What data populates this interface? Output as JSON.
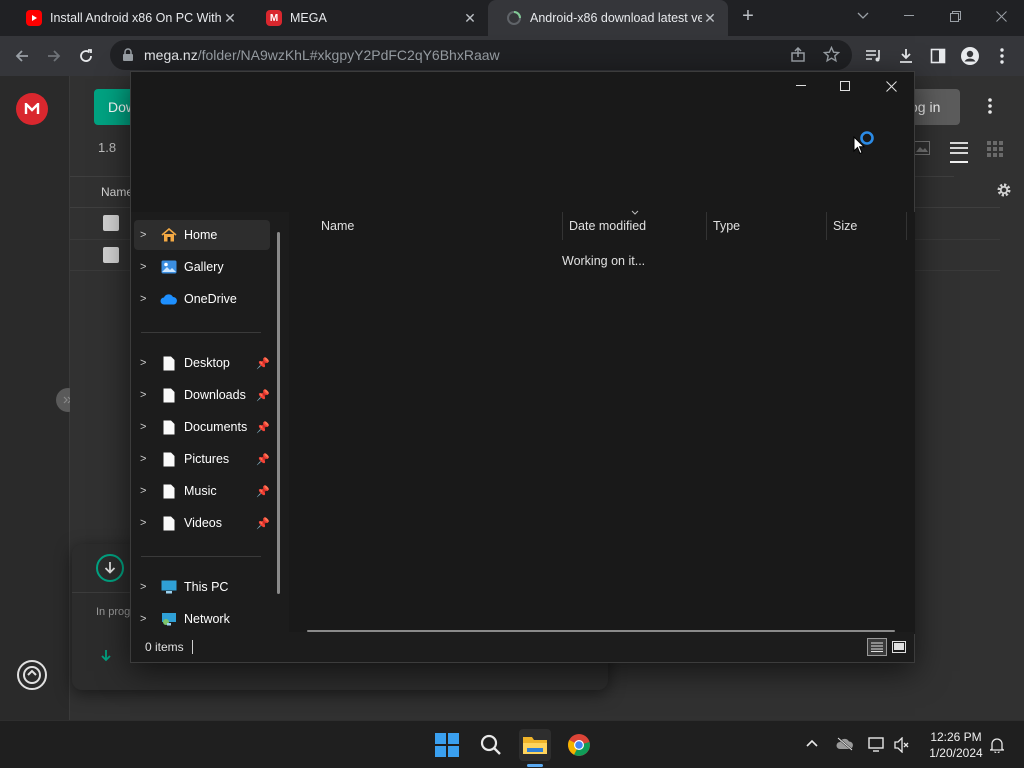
{
  "browser": {
    "tabs": [
      {
        "title": "Install Android x86 On PC Withou",
        "favicon": "youtube-icon"
      },
      {
        "title": "MEGA",
        "favicon": "mega-icon"
      },
      {
        "title": "Android-x86 download latest ver",
        "favicon": "loading-icon"
      }
    ],
    "url_domain": "mega.nz",
    "url_path": "/folder/NA9wzKhL#xkgpyY2PdFC2qY6BhxRaaw"
  },
  "mega": {
    "download_btn": "Dow",
    "login_btn": "og in",
    "size_text": "1.8",
    "name_header": "Name",
    "transfer_text": "In prog"
  },
  "dialog": {
    "nav": {
      "home": "Home",
      "gallery": "Gallery",
      "onedrive": "OneDrive",
      "desktop": "Desktop",
      "downloads": "Downloads",
      "documents": "Documents",
      "pictures": "Pictures",
      "music": "Music",
      "videos": "Videos",
      "this_pc": "This PC",
      "network": "Network"
    },
    "columns": {
      "name": "Name",
      "date_modified": "Date modified",
      "type": "Type",
      "size": "Size"
    },
    "working_text": "Working on it...",
    "status": "0 items"
  },
  "taskbar": {
    "time": "12:26 PM",
    "date": "1/20/2024"
  },
  "colors": {
    "mega_red": "#d9272e",
    "mega_green": "#00a382",
    "accent_blue": "#0078d4"
  }
}
